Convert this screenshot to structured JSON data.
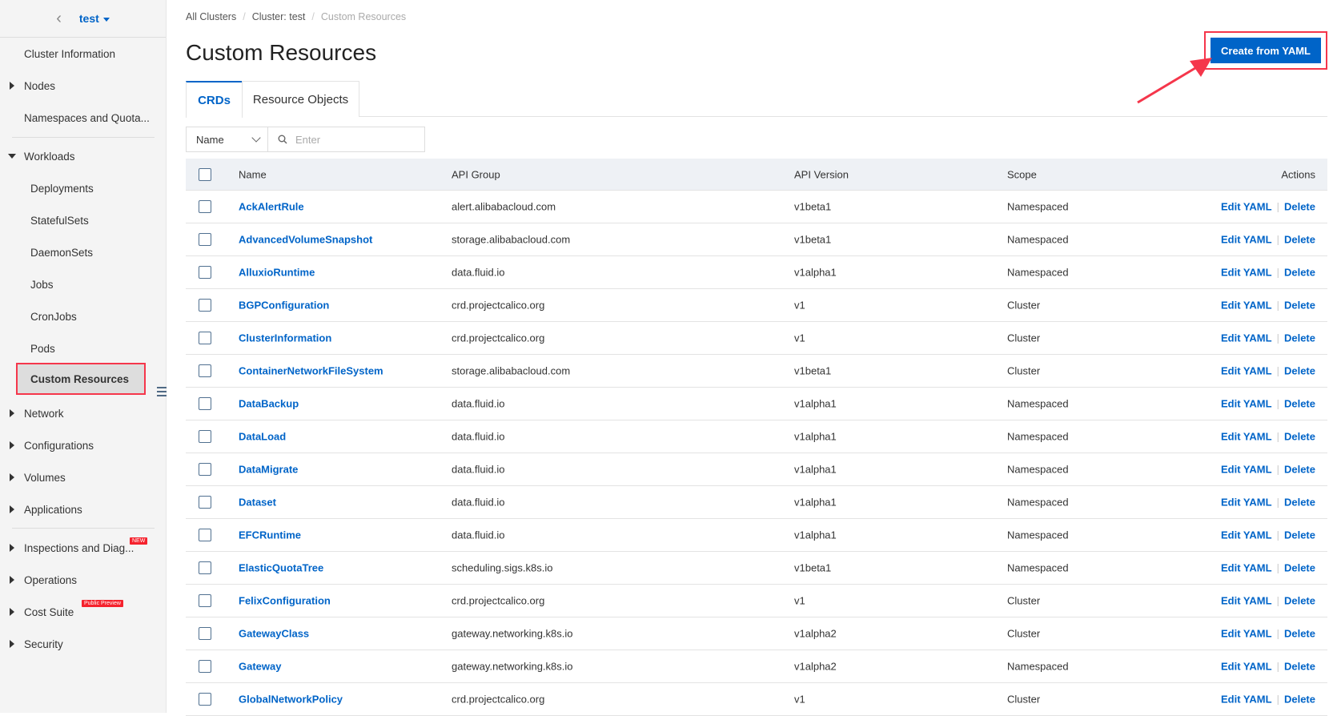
{
  "sidebar": {
    "cluster": "test",
    "items": [
      {
        "label": "Cluster Information",
        "arrow": "",
        "type": ""
      },
      {
        "label": "Nodes",
        "arrow": "r",
        "type": ""
      },
      {
        "label": "Namespaces and Quota...",
        "arrow": "",
        "type": ""
      },
      {
        "label": "Workloads",
        "arrow": "d",
        "type": ""
      },
      {
        "label": "Deployments",
        "arrow": "",
        "type": "sub"
      },
      {
        "label": "StatefulSets",
        "arrow": "",
        "type": "sub"
      },
      {
        "label": "DaemonSets",
        "arrow": "",
        "type": "sub"
      },
      {
        "label": "Jobs",
        "arrow": "",
        "type": "sub"
      },
      {
        "label": "CronJobs",
        "arrow": "",
        "type": "sub"
      },
      {
        "label": "Pods",
        "arrow": "",
        "type": "sub"
      },
      {
        "label": "Custom Resources",
        "arrow": "",
        "type": "active"
      },
      {
        "label": "Network",
        "arrow": "r",
        "type": ""
      },
      {
        "label": "Configurations",
        "arrow": "r",
        "type": ""
      },
      {
        "label": "Volumes",
        "arrow": "r",
        "type": ""
      },
      {
        "label": "Applications",
        "arrow": "r",
        "type": ""
      },
      {
        "label": "Inspections and Diag...",
        "arrow": "r",
        "type": "",
        "badge": "NEW"
      },
      {
        "label": "Operations",
        "arrow": "r",
        "type": ""
      },
      {
        "label": "Cost Suite",
        "arrow": "r",
        "type": "",
        "badge": "Public Preview"
      },
      {
        "label": "Security",
        "arrow": "r",
        "type": ""
      }
    ]
  },
  "breadcrumb": [
    "All Clusters",
    "Cluster: test",
    "Custom Resources"
  ],
  "title": "Custom Resources",
  "create_button": "Create from YAML",
  "tabs": [
    "CRDs",
    "Resource Objects"
  ],
  "filter": {
    "field": "Name",
    "placeholder": "Enter"
  },
  "table": {
    "headers": [
      "Name",
      "API Group",
      "API Version",
      "Scope",
      "Actions"
    ],
    "actions": [
      "Edit YAML",
      "Delete"
    ],
    "rows": [
      [
        "AckAlertRule",
        "alert.alibabacloud.com",
        "v1beta1",
        "Namespaced"
      ],
      [
        "AdvancedVolumeSnapshot",
        "storage.alibabacloud.com",
        "v1beta1",
        "Namespaced"
      ],
      [
        "AlluxioRuntime",
        "data.fluid.io",
        "v1alpha1",
        "Namespaced"
      ],
      [
        "BGPConfiguration",
        "crd.projectcalico.org",
        "v1",
        "Cluster"
      ],
      [
        "ClusterInformation",
        "crd.projectcalico.org",
        "v1",
        "Cluster"
      ],
      [
        "ContainerNetworkFileSystem",
        "storage.alibabacloud.com",
        "v1beta1",
        "Cluster"
      ],
      [
        "DataBackup",
        "data.fluid.io",
        "v1alpha1",
        "Namespaced"
      ],
      [
        "DataLoad",
        "data.fluid.io",
        "v1alpha1",
        "Namespaced"
      ],
      [
        "DataMigrate",
        "data.fluid.io",
        "v1alpha1",
        "Namespaced"
      ],
      [
        "Dataset",
        "data.fluid.io",
        "v1alpha1",
        "Namespaced"
      ],
      [
        "EFCRuntime",
        "data.fluid.io",
        "v1alpha1",
        "Namespaced"
      ],
      [
        "ElasticQuotaTree",
        "scheduling.sigs.k8s.io",
        "v1beta1",
        "Namespaced"
      ],
      [
        "FelixConfiguration",
        "crd.projectcalico.org",
        "v1",
        "Cluster"
      ],
      [
        "GatewayClass",
        "gateway.networking.k8s.io",
        "v1alpha2",
        "Cluster"
      ],
      [
        "Gateway",
        "gateway.networking.k8s.io",
        "v1alpha2",
        "Namespaced"
      ],
      [
        "GlobalNetworkPolicy",
        "crd.projectcalico.org",
        "v1",
        "Cluster"
      ]
    ]
  }
}
